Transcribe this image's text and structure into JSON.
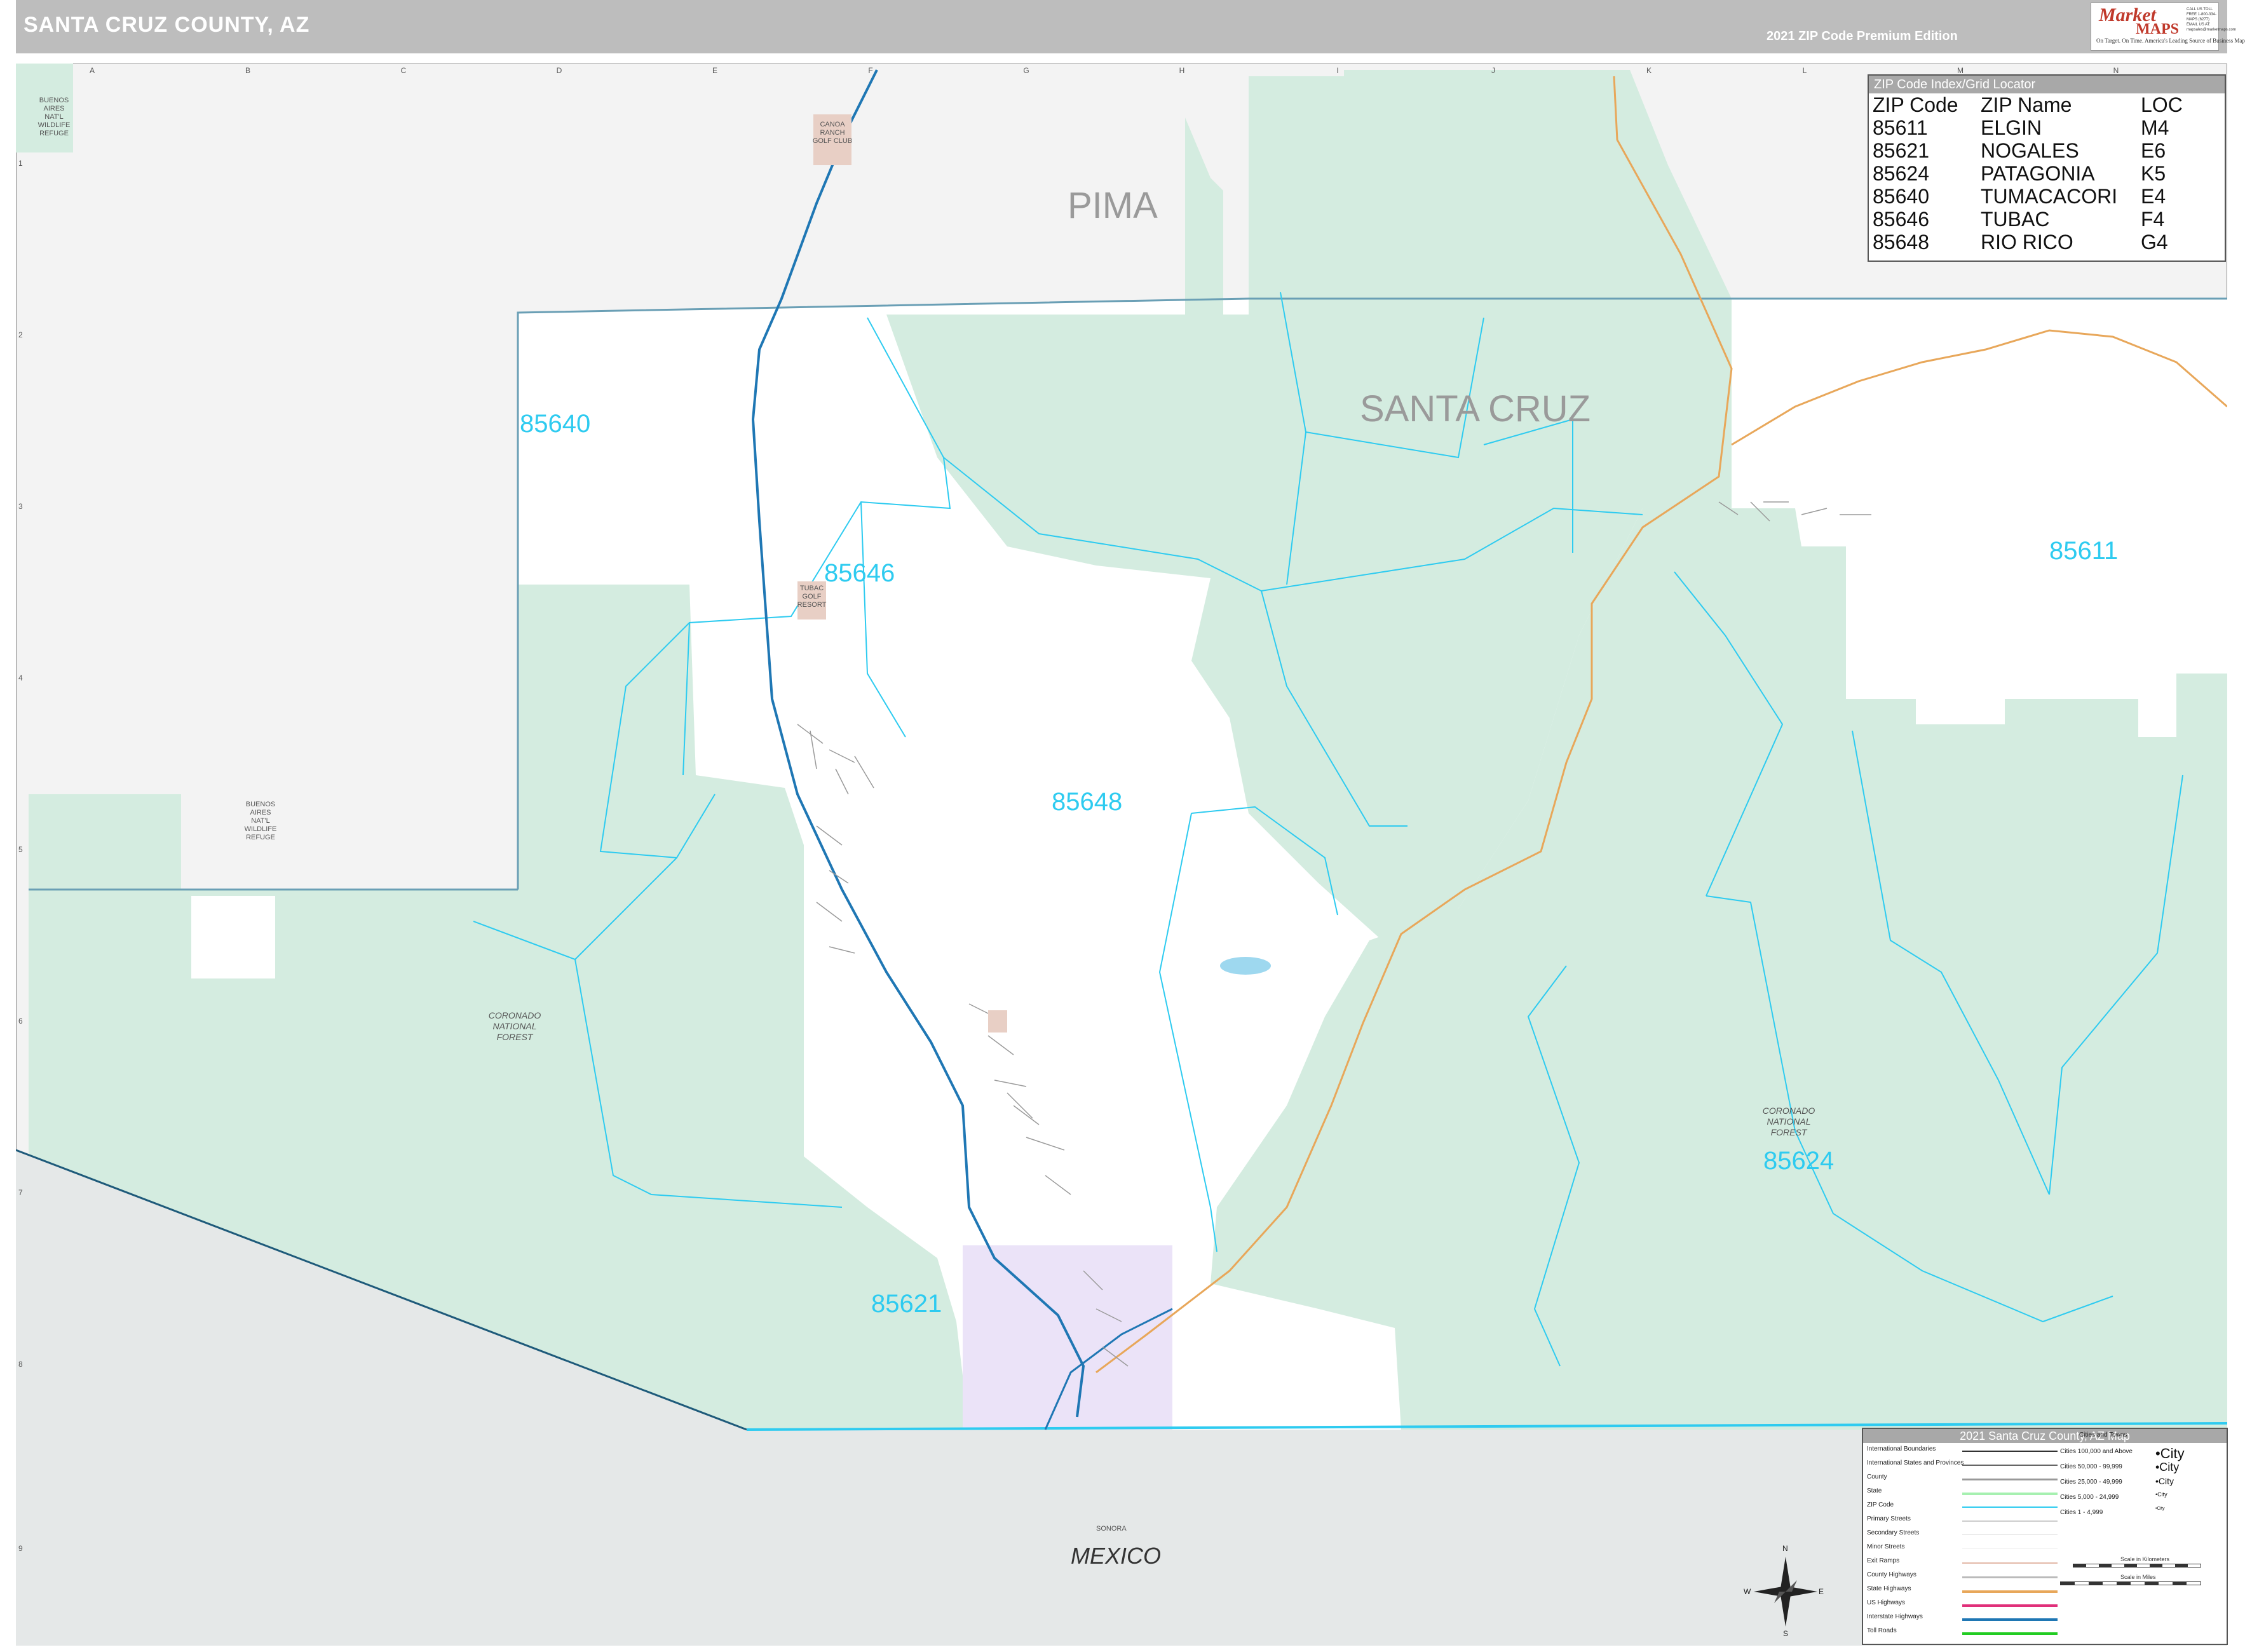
{
  "header": {
    "title": "SANTA CRUZ COUNTY, AZ",
    "edition": "2021 ZIP Code Premium Edition"
  },
  "logo": {
    "line1": "Market",
    "line2": "MAPS",
    "tagline": "On Target. On Time. America's Leading Source of Business Maps",
    "contact": "CALL US TOLL FREE 1-800-334-MAPS (6277) EMAIL US AT: mapsales@marketmaps.com"
  },
  "zip_index": {
    "title": "ZIP Code Index/Grid Locator",
    "columns": [
      "ZIP Code",
      "ZIP Name",
      "LOC"
    ],
    "rows": [
      [
        "85611",
        "ELGIN",
        "M4"
      ],
      [
        "85621",
        "NOGALES",
        "E6"
      ],
      [
        "85624",
        "PATAGONIA",
        "K5"
      ],
      [
        "85640",
        "TUMACACORI",
        "E4"
      ],
      [
        "85646",
        "TUBAC",
        "F4"
      ],
      [
        "85648",
        "RIO RICO",
        "G4"
      ]
    ]
  },
  "map": {
    "counties": [
      "PIMA",
      "SANTA CRUZ"
    ],
    "country": "MEXICO",
    "state_region": "SONORA",
    "zip_labels": [
      "85640",
      "85646",
      "85648",
      "85611",
      "85624",
      "85621"
    ],
    "areas": {
      "buenos_aires_1": "BUENOS AIRES NAT'L WILDLIFE REFUGE",
      "buenos_aires_2": "BUENOS AIRES NAT'L WILDLIFE REFUGE",
      "coronado_west": "CORONADO NATIONAL FOREST",
      "coronado_east": "CORONADO NATIONAL FOREST",
      "canoa": "CANOA RANCH GOLF CLUB",
      "tubac_golf": "TUBAC GOLF RESORT"
    },
    "grid_letters": [
      "A",
      "B",
      "C",
      "D",
      "E",
      "F",
      "G",
      "H",
      "I",
      "J",
      "K",
      "L",
      "M",
      "N"
    ],
    "grid_numbers": [
      "1",
      "2",
      "3",
      "4",
      "5",
      "6",
      "7",
      "8",
      "9"
    ],
    "colors": {
      "forest": "#d4ece0",
      "outside": "#f3f3f3",
      "mexico": "#e5e8e8",
      "zip_line": "#2ecbf0",
      "nogales_zone": "#ebe3f8",
      "interstate": "#1f77b4",
      "highway": "#e8a75a"
    }
  },
  "legend": {
    "title": "2021 Santa Cruz County, AZ Map",
    "line_items": [
      "International Boundaries",
      "International States and Provinces",
      "County",
      "State",
      "ZIP Code",
      "Primary Streets",
      "Secondary Streets",
      "Minor Streets",
      "Exit Ramps",
      "County Highways",
      "State Highways",
      "US Highways",
      "Interstate Highways",
      "Toll Roads"
    ],
    "cities_header": "Cities and Towns",
    "city_items": [
      "Cities 100,000 and Above",
      "Cities 50,000 - 99,999",
      "Cities 25,000 - 49,999",
      "Cities 5,000 - 24,999",
      "Cities 1 - 4,999"
    ],
    "city_samples": [
      "•City",
      "•City",
      "•City",
      "•City",
      "•City"
    ],
    "scale_km": "Scale in Kilometers",
    "scale_mi": "Scale in Miles"
  },
  "compass": {
    "n": "N",
    "s": "S",
    "e": "E",
    "w": "W"
  }
}
